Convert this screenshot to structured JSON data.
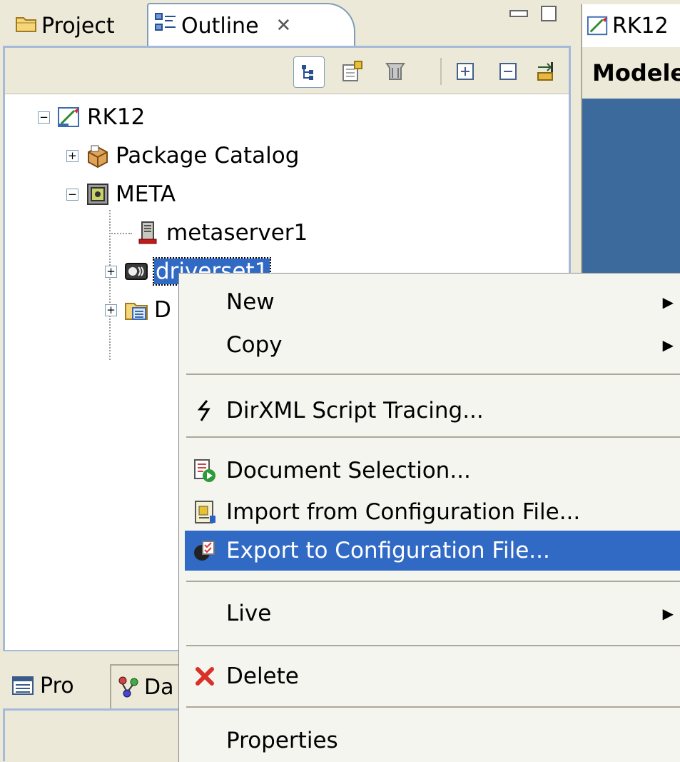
{
  "tabs": {
    "project": "Project",
    "outline": "Outline",
    "outline_close": "✕"
  },
  "tree": {
    "root": "RK12",
    "package_catalog": "Package Catalog",
    "meta": "META",
    "metaserver": "metaserver1",
    "driverset": "driverset1",
    "partial_node": "D"
  },
  "bottom_tabs": {
    "pro": "Pro",
    "da": "Da"
  },
  "editor": {
    "tab_label": "RK12",
    "header": "Modeler"
  },
  "menu": {
    "new": "New",
    "copy": "Copy",
    "script_tracing": "DirXML Script Tracing...",
    "document_selection": "Document Selection...",
    "import_config": "Import from Configuration File...",
    "export_config": "Export to Configuration File...",
    "live": "Live",
    "delete": "Delete",
    "properties": "Properties"
  },
  "colors": {
    "selection": "#316ac5",
    "menu_bg": "#f5f5f0",
    "chrome": "#ece9d8",
    "editor_canvas": "#3d6a9c"
  },
  "icons": {
    "project_tab": "folder-icon",
    "outline_tab": "outline-icon",
    "root": "modeler-icon",
    "package_catalog": "package-icon",
    "meta": "meta-icon",
    "metaserver": "server-icon",
    "driverset": "driverset-icon",
    "script_tracing": "trace-icon",
    "document_selection": "document-selection-icon",
    "import_config": "import-icon",
    "export_config": "export-icon",
    "delete": "delete-icon"
  }
}
